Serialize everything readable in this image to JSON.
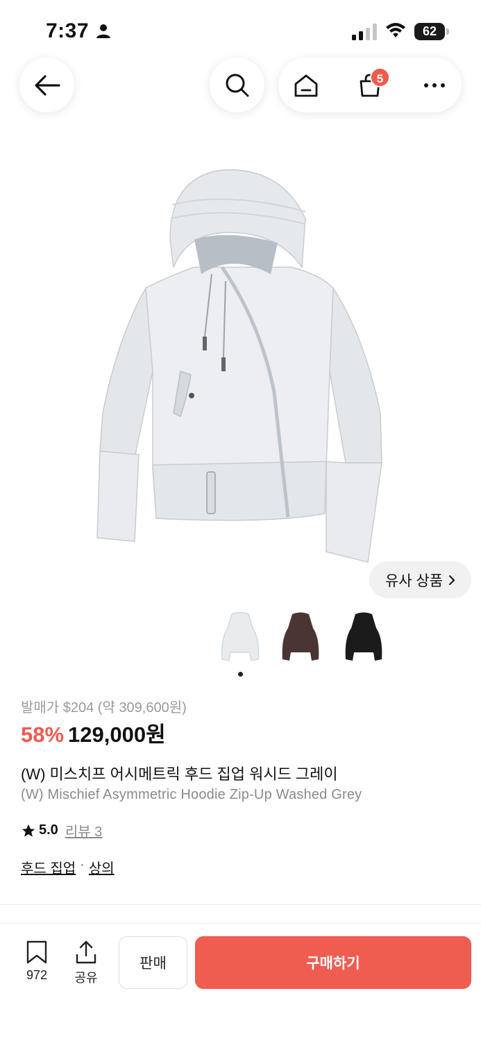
{
  "status_bar": {
    "time": "7:37",
    "battery": "62"
  },
  "nav": {
    "cart_count": "5"
  },
  "similar_button": {
    "label": "유사 상품"
  },
  "product": {
    "release_price": "발매가 $204 (약 309,600원)",
    "discount": "58%",
    "price": "129,000원",
    "title_ko": "(W) 미스치프 어시메트릭 후드 집업 워시드 그레이",
    "title_en": "(W) Mischief Asymmetric Hoodie Zip-Up Washed Grey",
    "rating": "5.0",
    "review_label": "리뷰 3",
    "categories": [
      "후드 집업",
      "상의"
    ],
    "category_separator": "·"
  },
  "thumbnails": [
    {
      "color": "#e9ecef"
    },
    {
      "color": "#4a3533"
    },
    {
      "color": "#1b1b1b"
    }
  ],
  "bottom_bar": {
    "bookmark_count": "972",
    "share_label": "공유",
    "sell_label": "판매",
    "buy_label": "구매하기"
  },
  "colors": {
    "accent": "#ef5a4d"
  }
}
